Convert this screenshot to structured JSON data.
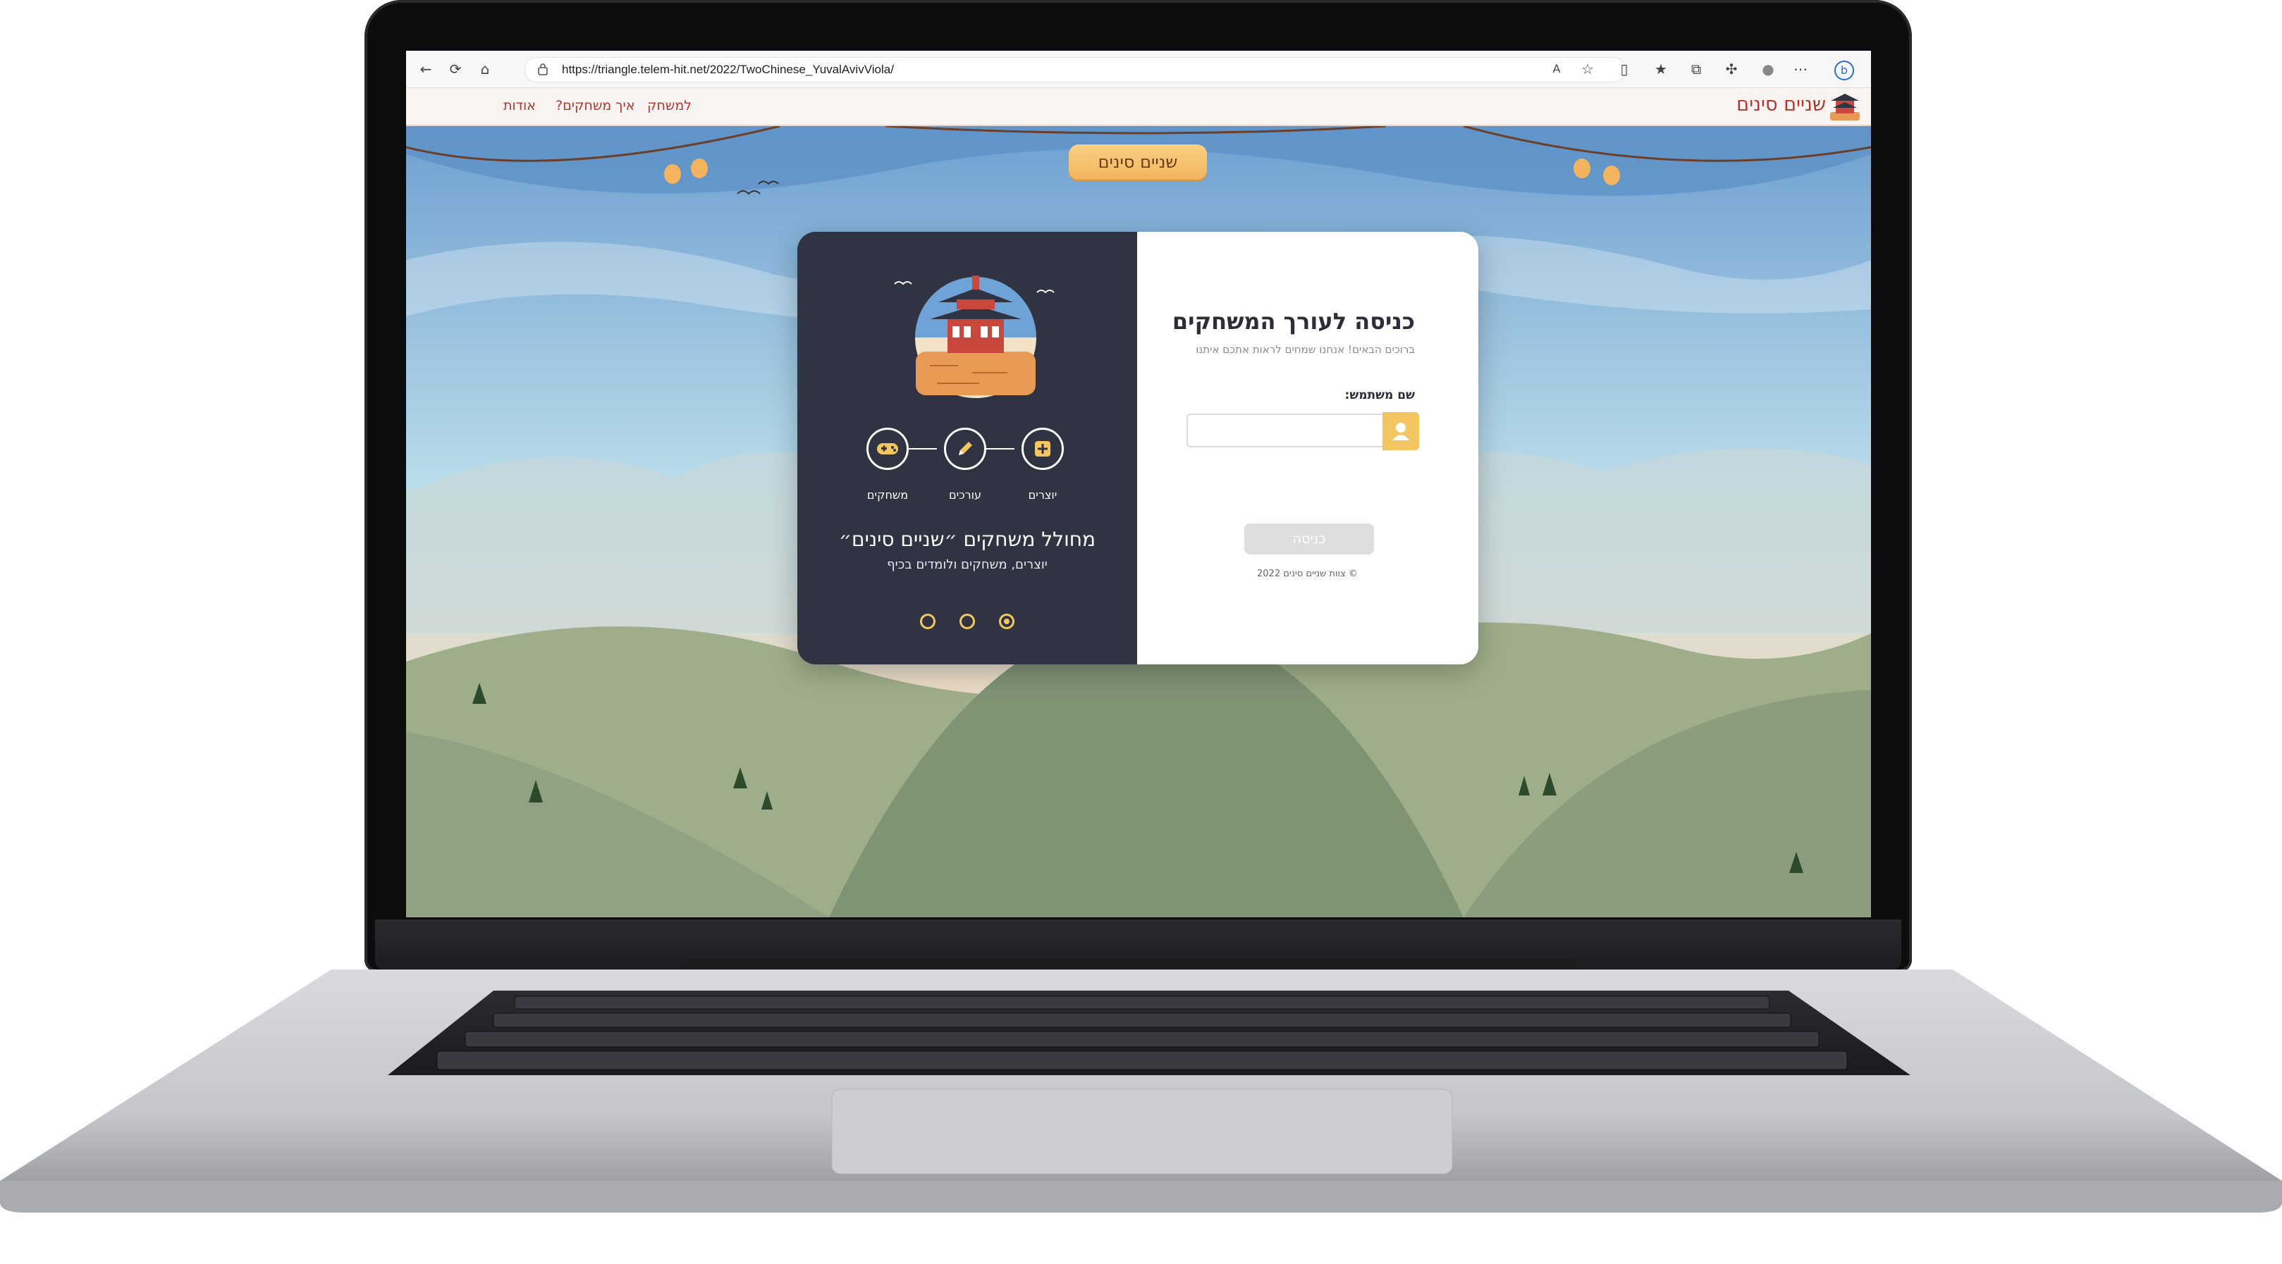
{
  "browser": {
    "url": "https://triangle.telem-hit.net/2022/TwoChinese_YuvalAvivViola/",
    "icons": [
      "back-icon",
      "refresh-icon",
      "home-icon",
      "lock-icon",
      "read-aloud-icon",
      "favorite-icon",
      "split-screen-icon",
      "favorites-bar-icon",
      "collections-icon",
      "extensions-icon",
      "profile-icon",
      "more-icon",
      "bing-icon"
    ]
  },
  "site": {
    "brand": "שניים סינים",
    "nav": [
      "אודות",
      "איך משחקים?",
      "למשחק"
    ]
  },
  "scene": {
    "tag": "שניים סינים"
  },
  "login": {
    "title": "כניסה לעורך המשחקים",
    "subtitle": "ברוכים הבאים! אנחנו שמחים לראות אתכם איתנו",
    "username_label": "שם משתמש:",
    "username_value": "",
    "button": "כניסה",
    "footer": "צוות שניים סינים 2022"
  },
  "info": {
    "steps": [
      "יוצרים",
      "עורכים",
      "משחקים"
    ],
    "title": "מחולל משחקים ״שניים סינים״",
    "subtitle": "יוצרים, משחקים ולומדים בכיף",
    "carousel_active": 3
  },
  "colors": {
    "accent": "#f3c661",
    "brand_red": "#b3372f",
    "card_dark": "#2f3342"
  }
}
